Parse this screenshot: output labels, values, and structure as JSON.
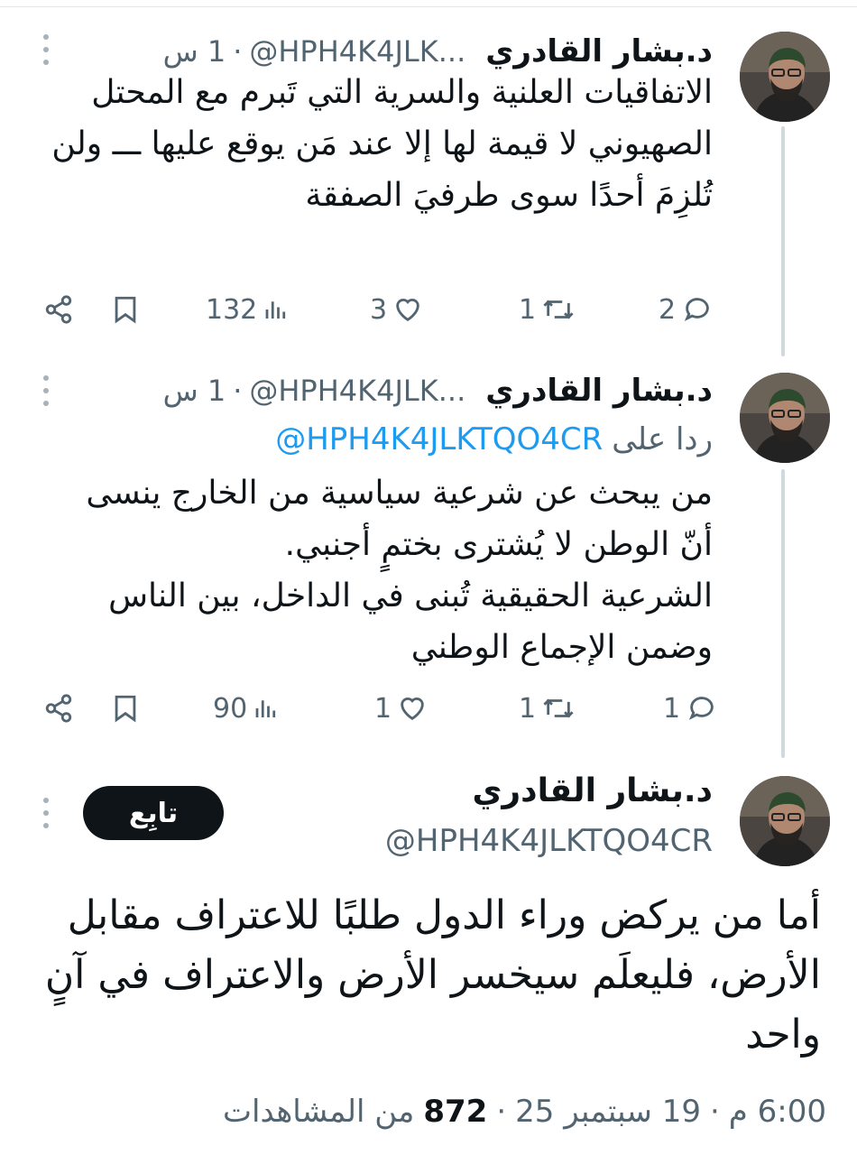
{
  "tweets": [
    {
      "name": "د.بشار القادري",
      "handle": "@HPH4K4JLK...",
      "dot": "·",
      "time": "1 س",
      "text": "الاتفاقيات العلنية والسرية التي تَبرم مع المحتل الصهيوني لا قيمة لها إلا عند مَن يوقع عليها ـــ ولن تُلزِمَ أحدًا سوى طرفيَ الصفقة",
      "replies": "2",
      "retweets": "1",
      "likes": "3",
      "views": "132"
    },
    {
      "name": "د.بشار القادري",
      "handle": "@HPH4K4JLK...",
      "dot": "·",
      "time": "1 س",
      "reply_prefix": "ردا على",
      "reply_mention": "@HPH4K4JLKTQO4CR",
      "text": "من يبحث عن شرعية سياسية من الخارج ينسى أنّ الوطن لا يُشترى بختمٍ أجنبي.\nالشرعية الحقيقية تُبنى في الداخل، بين الناس وضمن الإجماع الوطني",
      "replies": "1",
      "retweets": "1",
      "likes": "1",
      "views": "90"
    }
  ],
  "main_tweet": {
    "name": "د.بشار القادري",
    "handle": "@HPH4K4JLKTQO4CR",
    "follow_label": "تابِع",
    "text": "أما من يركض وراء الدول طلبًا للاعتراف مقابل الأرض، فليعلَم سيخسر الأرض والاعتراف في آنٍ واحد",
    "time": "6:00 م",
    "date": "19 سبتمبر 25",
    "views_count": "872",
    "views_label": "من المشاهدات",
    "sep": "·"
  },
  "icons": {
    "reply": "reply-icon",
    "retweet": "retweet-icon",
    "like": "heart-icon",
    "views": "views-chart-icon",
    "bookmark": "bookmark-icon",
    "share": "share-icon",
    "more": "more-vertical-icon"
  },
  "colors": {
    "text": "#0f1419",
    "secondary": "#536471",
    "link": "#1d9bf0",
    "thread_line": "#cfd9de",
    "follow_button": "#0f1419"
  }
}
